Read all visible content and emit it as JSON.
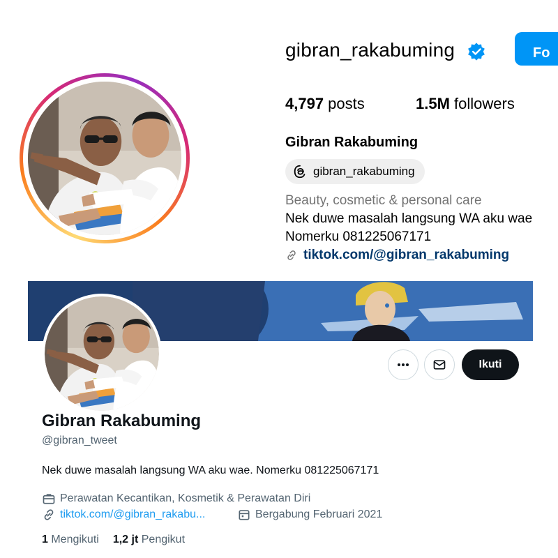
{
  "instagram": {
    "username": "gibran_rakabuming",
    "follow_label": "Fo",
    "stats": [
      {
        "value": "4,797",
        "label": " posts"
      },
      {
        "value": "1.5M",
        "label": " followers"
      }
    ],
    "display_name": "Gibran Rakabuming",
    "threads_handle": "gibran_rakabuming",
    "category": "Beauty, cosmetic & personal care",
    "bio_line1": "Nek duwe masalah langsung WA aku wae",
    "bio_line2": "Nomerku 081225067171",
    "link": "tiktok.com/@gibran_rakabuming",
    "colors": {
      "follow_button": "#0095f6",
      "verified": "#0095f6",
      "link": "#00376b"
    }
  },
  "twitter": {
    "follow_label": "Ikuti",
    "display_name": "Gibran Rakabuming",
    "handle": "@gibran_tweet",
    "bio": "Nek duwe masalah langsung WA aku wae. Nomerku 081225067171",
    "category": "Perawatan Kecantikan, Kosmetik & Perawatan Diri",
    "link": "tiktok.com/@gibran_rakabu...",
    "joined": "Bergabung Februari 2021",
    "following_count": "1",
    "following_label": " Mengikuti",
    "followers_count": "1,2 jt",
    "followers_label": " Pengikut",
    "icons": [
      "more-icon",
      "mail-icon",
      "briefcase-icon",
      "link-icon",
      "calendar-icon"
    ],
    "colors": {
      "follow_button": "#0f1419",
      "link": "#1d9bf0",
      "secondary_text": "#536471"
    }
  }
}
